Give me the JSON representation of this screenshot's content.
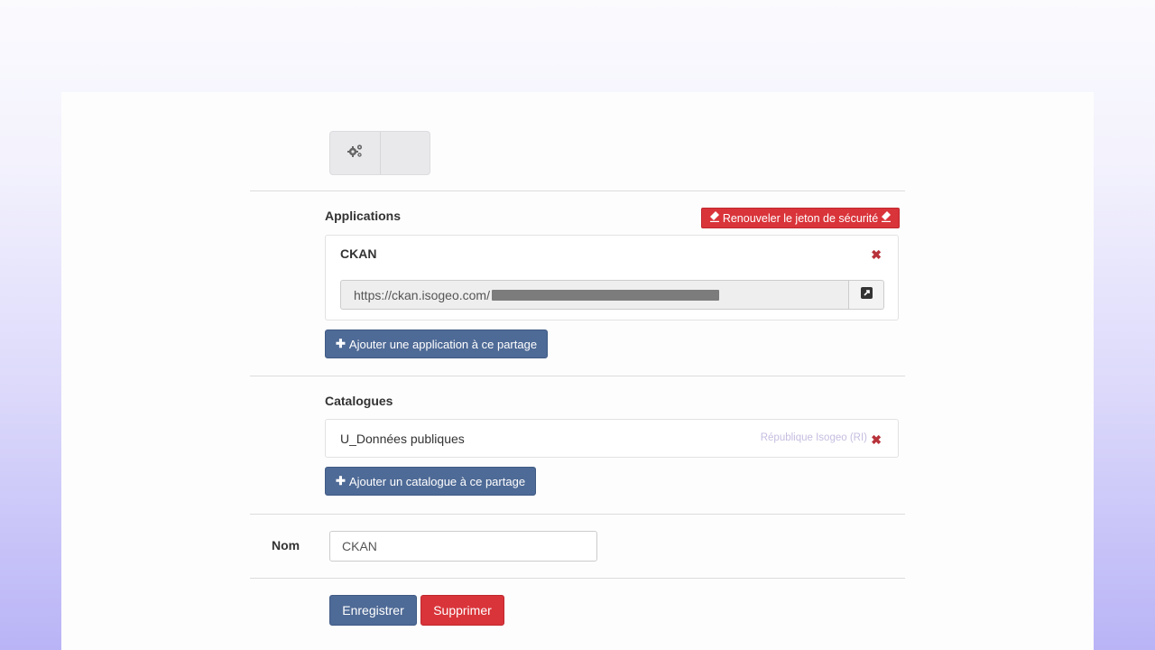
{
  "toolbar": {
    "buttons": [
      {
        "icon": "gears-icon"
      },
      {
        "icon": "blank"
      }
    ]
  },
  "applications": {
    "heading": "Applications",
    "renew_token_label": "Renouveler le jeton de sécurité",
    "items": [
      {
        "name": "CKAN",
        "url": "https://ckan.isogeo.com/"
      }
    ],
    "add_label": "Ajouter une application à ce partage"
  },
  "catalogs": {
    "heading": "Catalogues",
    "items": [
      {
        "name": "U_Données publiques",
        "owner": "République Isogeo (RI)"
      }
    ],
    "add_label": "Ajouter un catalogue à ce partage"
  },
  "form": {
    "name_label": "Nom",
    "name_value": "CKAN"
  },
  "actions": {
    "save_label": "Enregistrer",
    "delete_label": "Supprimer"
  },
  "colors": {
    "primary": "#4e6a96",
    "danger": "#d9343a",
    "remove": "#b8323a"
  }
}
